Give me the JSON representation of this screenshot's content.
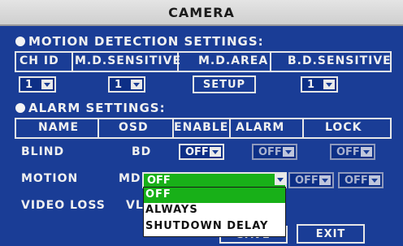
{
  "window": {
    "title": "CAMERA"
  },
  "motion_section": {
    "heading": "MOTION DETECTION SETTINGS:",
    "columns": [
      "CH ID",
      "M.D.SENSITIVE",
      "M.D.AREA",
      "B.D.SENSITIVE"
    ],
    "ch_id_value": "1",
    "md_sensitive_value": "1",
    "md_area_button": "SETUP",
    "bd_sensitive_value": "1"
  },
  "alarm_section": {
    "heading": "ALARM SETTINGS:",
    "columns": [
      "NAME",
      "OSD",
      "ENABLE",
      "ALARM",
      "LOCK"
    ],
    "rows": [
      {
        "name": "BLIND",
        "osd": "BD",
        "enable": "OFF",
        "alarm": "OFF",
        "lock": "OFF"
      },
      {
        "name": "MOTION",
        "osd": "MD",
        "enable": "OFF",
        "alarm": "OFF",
        "lock": "OFF"
      },
      {
        "name": "VIDEO LOSS",
        "osd": "VL"
      }
    ]
  },
  "dropdown": {
    "selected": "OFF",
    "options": [
      "OFF",
      "ALWAYS",
      "SHUTDOWN DELAY"
    ],
    "highlighted_index": 0
  },
  "footer": {
    "save_button": "SAVE",
    "exit_button": "EXIT"
  },
  "colors": {
    "background": "#1a3d96",
    "highlight": "#18b018",
    "titlebar": "#d8d8d8"
  }
}
